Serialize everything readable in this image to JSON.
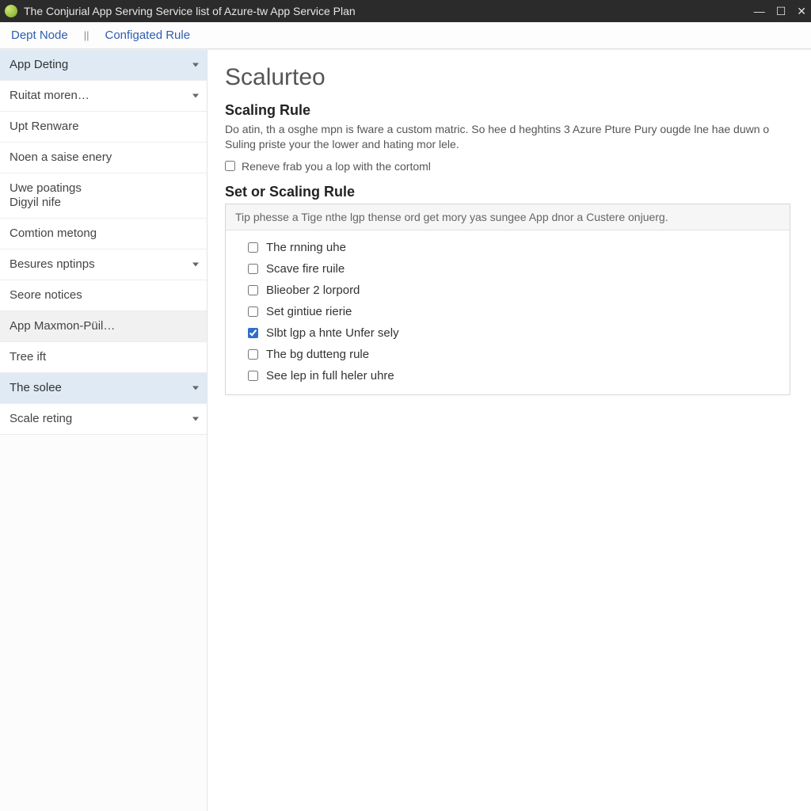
{
  "window": {
    "title": "The Conjurial App Serving Service list of Azure-tw App Service Plan"
  },
  "breadcrumb": {
    "first": "Dept Node",
    "sep": "||",
    "second": "Configated Rule"
  },
  "sidebar": {
    "items": [
      {
        "label": "App Deting",
        "kind": "header",
        "collapsible": true
      },
      {
        "label": "Ruitat moren…",
        "collapsible": true
      },
      {
        "label": "Upt Renware"
      },
      {
        "label": "Noen a saise enery"
      },
      {
        "label": "Uwe poatings\nDigyil nife"
      },
      {
        "label": "Comtion metong"
      },
      {
        "label": "Besures nptinps",
        "collapsible": true
      },
      {
        "label": "Seore notices"
      },
      {
        "label": "App Maxmon-Püil…",
        "highlight": true
      },
      {
        "label": "Tree ift"
      },
      {
        "label": "The solee",
        "kind": "header",
        "collapsible": true
      },
      {
        "label": "Scale reting",
        "collapsible": true
      }
    ]
  },
  "main": {
    "title": "Scalurteo",
    "section1_heading": "Scaling Rule",
    "section1_desc": "Do atin, th a osghe mpn is fware a custom matric. So hee d heghtins 3 Azure Pture Pury ougde lne hae duwn o Suling priste your the lower and hating mor lele.",
    "checkbox_remove_label": "Reneve frab you a lop with the cortoml",
    "section2_heading": "Set or Scaling Rule",
    "rule_hint": "Tip phesse a Tige nthe lgp thense ord get mory yas sungee App dnor a Custere onjuerg.",
    "options": [
      {
        "label": "The rnning uhe",
        "checked": false
      },
      {
        "label": "Scave fire ruile",
        "checked": false
      },
      {
        "label": "Blieober 2 lorpord",
        "checked": false
      },
      {
        "label": "Set gintiue rierie",
        "checked": false
      },
      {
        "label": "Slbt lgp a hnte Unfer sely",
        "checked": true
      },
      {
        "label": "The bg dutteng rule",
        "checked": false
      },
      {
        "label": "See lep in full heler uhre",
        "checked": false
      }
    ]
  }
}
